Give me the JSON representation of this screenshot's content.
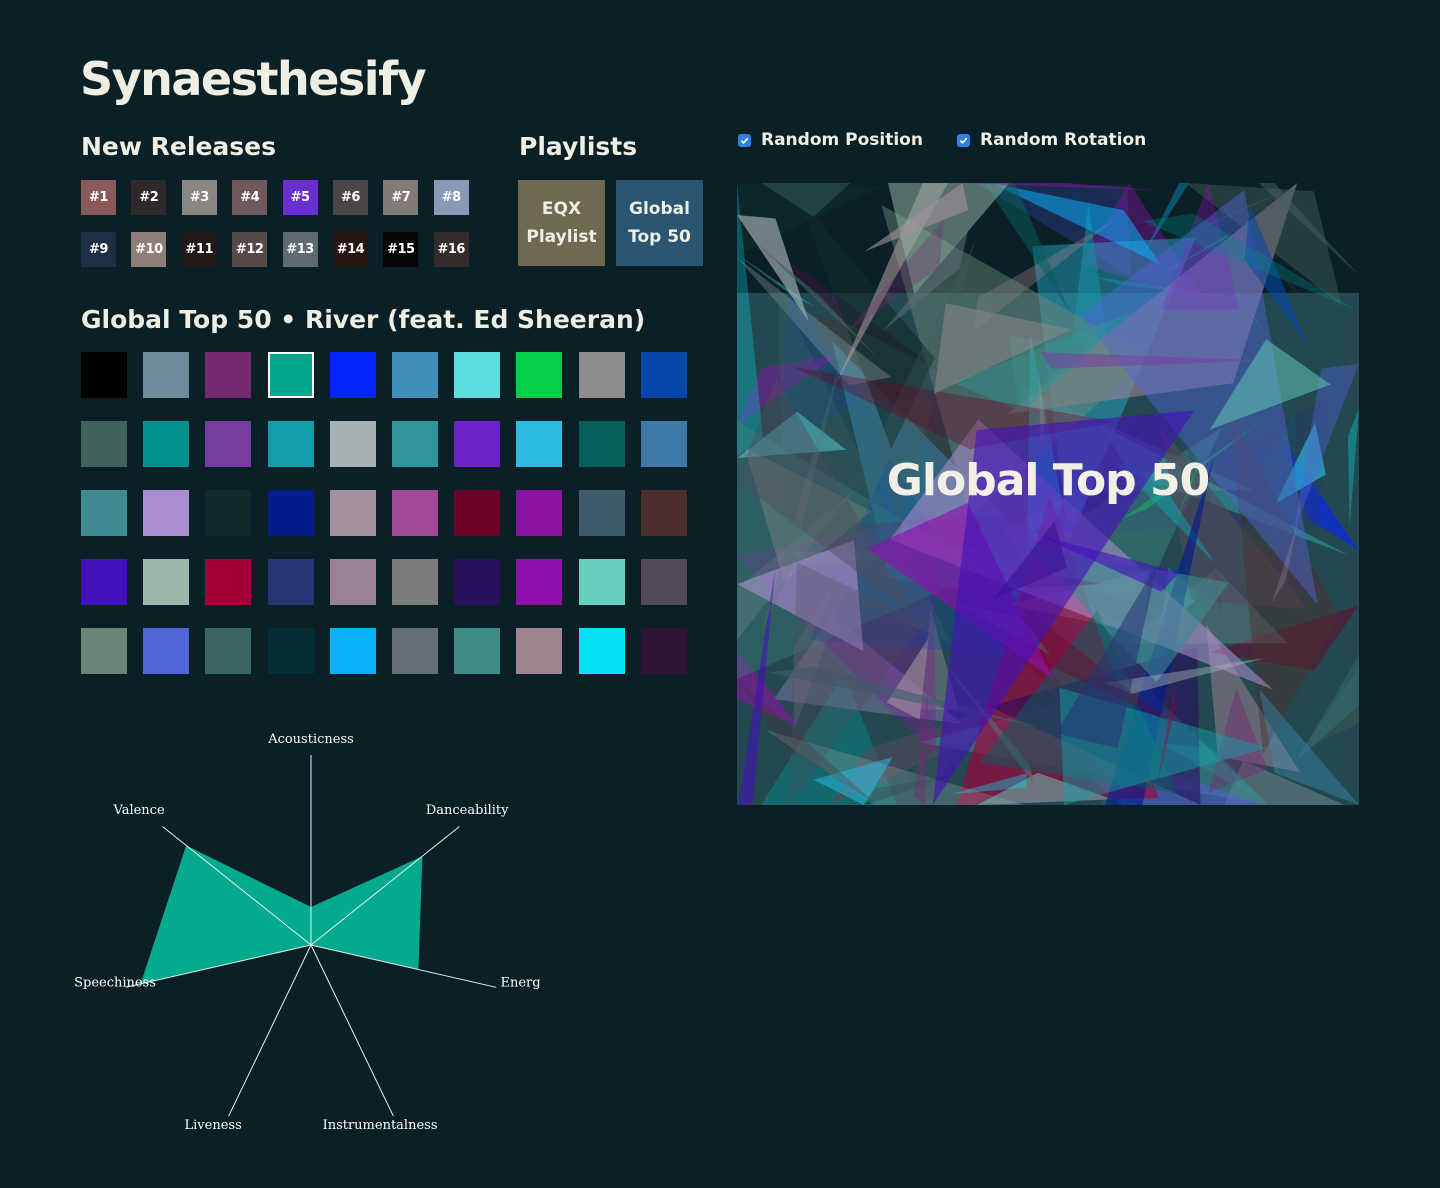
{
  "app": {
    "title": "Synaesthesify"
  },
  "new_releases": {
    "title": "New Releases",
    "items": [
      {
        "label": "#1",
        "color": "#8a5a5a"
      },
      {
        "label": "#2",
        "color": "#2f2a2a"
      },
      {
        "label": "#3",
        "color": "#8a8682"
      },
      {
        "label": "#4",
        "color": "#6e5a5c"
      },
      {
        "label": "#5",
        "color": "#6a2fd0"
      },
      {
        "label": "#6",
        "color": "#4a4648"
      },
      {
        "label": "#7",
        "color": "#847a76"
      },
      {
        "label": "#8",
        "color": "#8a98b8"
      },
      {
        "label": "#9",
        "color": "#1e2e44"
      },
      {
        "label": "#10",
        "color": "#8e7e7a"
      },
      {
        "label": "#11",
        "color": "#221a16"
      },
      {
        "label": "#12",
        "color": "#564a48"
      },
      {
        "label": "#13",
        "color": "#5e6c72"
      },
      {
        "label": "#14",
        "color": "#261612"
      },
      {
        "label": "#15",
        "color": "#050505"
      },
      {
        "label": "#16",
        "color": "#342c2a"
      }
    ]
  },
  "playlists": {
    "title": "Playlists",
    "items": [
      {
        "line1": "EQX",
        "line2": "Playlist",
        "color": "#6e6a52"
      },
      {
        "line1": "Global",
        "line2": "Top 50",
        "color": "#2a5674"
      }
    ]
  },
  "options": {
    "random_position": {
      "label": "Random Position",
      "checked": true
    },
    "random_rotation": {
      "label": "Random Rotation",
      "checked": true
    }
  },
  "track": {
    "title": "Global Top 50 • River (feat. Ed Sheeran)",
    "selected_index": 3,
    "palette": [
      "#000000",
      "#6c8c9c",
      "#732a72",
      "#04a78c",
      "#0525fc",
      "#3f8fb9",
      "#5adce0",
      "#04cf4c",
      "#8c8c8c",
      "#0547a9",
      "#41615d",
      "#00908e",
      "#773ea0",
      "#139ea9",
      "#a4b2b4",
      "#2f979c",
      "#6e22c9",
      "#2cbbe1",
      "#075f5b",
      "#3f79a9",
      "#3e8c92",
      "#a98fcf",
      "#102a29",
      "#041b8c",
      "#a3919b",
      "#a34898",
      "#6d0329",
      "#8a14a1",
      "#3e5c6c",
      "#4b2f2f",
      "#4211b9",
      "#9ab7a9",
      "#a3003a",
      "#263573",
      "#9a8292",
      "#7d7d7d",
      "#29105e",
      "#8f0fac",
      "#64cfbd",
      "#524a5a",
      "#6b8676",
      "#5065d6",
      "#3a6662",
      "#032e34",
      "#08b2f9",
      "#626f78",
      "#3e8d84",
      "#9e8590",
      "#03e1f5",
      "#301436"
    ]
  },
  "art": {
    "title": "Global Top 50"
  },
  "radar": {
    "accent": "#03aa8e",
    "axes": [
      {
        "label": "Acousticness",
        "value": 0.2
      },
      {
        "label": "Danceability",
        "value": 0.75
      },
      {
        "label": "Energy",
        "value": 0.58
      },
      {
        "label": "Instrumentalness",
        "value": 0.0
      },
      {
        "label": "Liveness",
        "value": 0.0
      },
      {
        "label": "Speechiness",
        "value": 0.92
      },
      {
        "label": "Valence",
        "value": 0.84
      }
    ]
  }
}
